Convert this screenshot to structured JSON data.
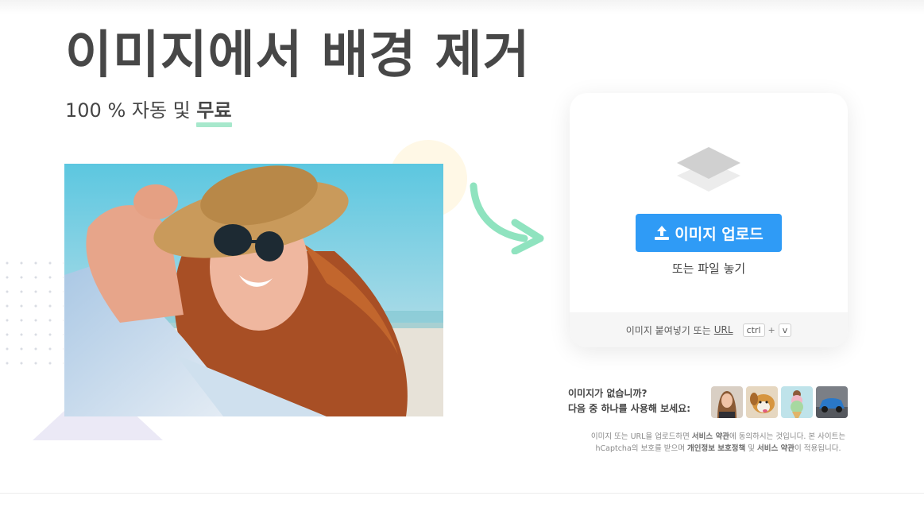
{
  "hero": {
    "title": "이미지에서 배경 제거",
    "subtitle_prefix": "100 % 자동 및 ",
    "subtitle_highlight": "무료"
  },
  "upload": {
    "button_label": "이미지 업로드",
    "drop_text": "또는 파일 놓기",
    "paste_text": "이미지 붙여넣기 또는",
    "url_label": "URL",
    "key_ctrl": "ctrl",
    "key_plus": "+",
    "key_v": "v"
  },
  "samples": {
    "line1": "이미지가 없습니까?",
    "line2": "다음 중 하나를 사용해 보세요:",
    "thumbs": [
      "woman-portrait",
      "puppy",
      "ice-cream",
      "blue-car"
    ]
  },
  "legal": {
    "part1": "이미지 또는 URL을 업로드하면 ",
    "terms1": "서비스 약관",
    "part2": "에 동의하시는 것입니다. 본 사이트는 hCaptcha의 보호를 받으며 ",
    "privacy": "개인정보 보호정책",
    "part3": " 및 ",
    "terms2": "서비스 약관",
    "part4": "이 적용됩니다."
  },
  "colors": {
    "accent_blue": "#2f9bf6",
    "highlight_green": "#a7e8cc",
    "arrow_green": "#8fe3bf"
  }
}
